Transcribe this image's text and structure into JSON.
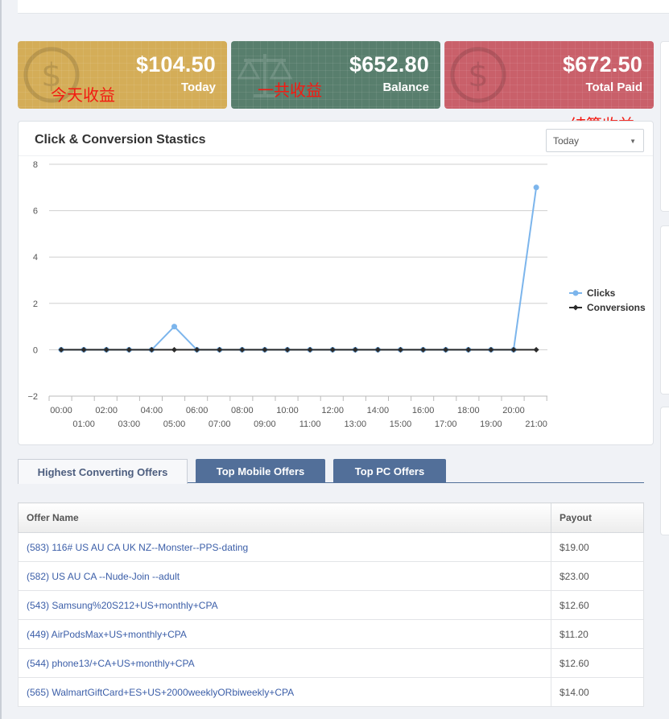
{
  "stats": [
    {
      "amount": "$104.50",
      "label": "Today",
      "icon": "dollar-icon"
    },
    {
      "amount": "$652.80",
      "label": "Balance",
      "icon": "scale-icon"
    },
    {
      "amount": "$672.50",
      "label": "Total Paid",
      "icon": "dollar-icon"
    }
  ],
  "annotations": {
    "today": "今天收益",
    "balance": "一共收益",
    "paid": "结算收益"
  },
  "chart": {
    "title": "Click & Conversion Stastics",
    "period": "Today"
  },
  "chart_data": {
    "type": "line",
    "x": [
      "00:00",
      "01:00",
      "02:00",
      "03:00",
      "04:00",
      "05:00",
      "06:00",
      "07:00",
      "08:00",
      "09:00",
      "10:00",
      "11:00",
      "12:00",
      "13:00",
      "14:00",
      "15:00",
      "16:00",
      "17:00",
      "18:00",
      "19:00",
      "20:00",
      "21:00"
    ],
    "series": [
      {
        "name": "Clicks",
        "values": [
          0,
          0,
          0,
          0,
          0,
          1,
          0,
          0,
          0,
          0,
          0,
          0,
          0,
          0,
          0,
          0,
          0,
          0,
          0,
          0,
          0,
          7
        ],
        "color": "#7cb5ec"
      },
      {
        "name": "Conversions",
        "values": [
          0,
          0,
          0,
          0,
          0,
          0,
          0,
          0,
          0,
          0,
          0,
          0,
          0,
          0,
          0,
          0,
          0,
          0,
          0,
          0,
          0,
          0
        ],
        "color": "#2b2b2b"
      }
    ],
    "yticks": [
      "8",
      "6",
      "4",
      "2",
      "0",
      "−2"
    ],
    "ylim": [
      -2,
      8
    ],
    "grid": true,
    "legend": "right"
  },
  "tabs": [
    "Highest Converting Offers",
    "Top Mobile Offers",
    "Top PC Offers"
  ],
  "table": {
    "headers": [
      "Offer Name",
      "Payout"
    ],
    "rows": [
      [
        "(583) 116# US AU CA UK NZ--Monster--PPS-dating",
        "$19.00"
      ],
      [
        "(582) US AU CA --Nude-Join --adult",
        "$23.00"
      ],
      [
        "(543) Samsung%20S212+US+monthly+CPA",
        "$12.60"
      ],
      [
        "(449) AirPodsMax+US+monthly+CPA",
        "$11.20"
      ],
      [
        "(544) phone13/+CA+US+monthly+CPA",
        "$12.60"
      ],
      [
        "(565) WalmartGiftCard+ES+US+2000weeklyORbiweekly+CPA",
        "$14.00"
      ]
    ]
  },
  "colors": {
    "today": "#d4ad58",
    "balance": "#587e6d",
    "paid": "#c9606a",
    "tab": "#526f99",
    "link": "#3b5ea8"
  }
}
